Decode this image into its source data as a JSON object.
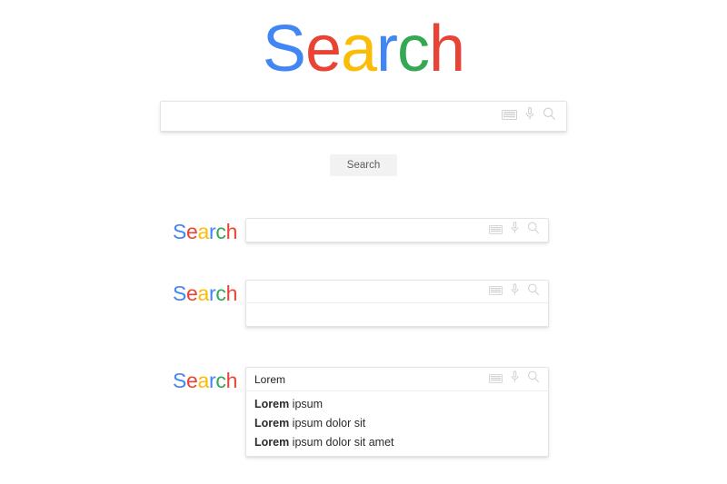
{
  "logo": {
    "letters": [
      {
        "char": "S",
        "color": "#4285F4"
      },
      {
        "char": "e",
        "color": "#EA4335"
      },
      {
        "char": "a",
        "color": "#FBBC05"
      },
      {
        "char": "r",
        "color": "#4285F4"
      },
      {
        "char": "c",
        "color": "#34A853"
      },
      {
        "char": "h",
        "color": "#EA4335"
      }
    ],
    "text": "Search"
  },
  "hero": {
    "input": {
      "value": "",
      "placeholder": ""
    },
    "icons": [
      "keyboard-icon",
      "microphone-icon",
      "magnifier-icon"
    ]
  },
  "button": {
    "label": "Search"
  },
  "row2": {
    "logo": "Search",
    "input": {
      "value": "",
      "placeholder": ""
    }
  },
  "row3": {
    "logo": "Search",
    "input": {
      "value": "",
      "placeholder": ""
    },
    "dropdown_empty": true
  },
  "row4": {
    "logo": "Search",
    "input": {
      "value": "Lorem",
      "placeholder": ""
    },
    "suggestions": [
      {
        "match": "Lorem",
        "rest": " ipsum"
      },
      {
        "match": "Lorem",
        "rest": " ipsum dolor sit"
      },
      {
        "match": "Lorem",
        "rest": " ipsum dolor sit amet"
      }
    ]
  },
  "colors": {
    "blue": "#4285F4",
    "red": "#EA4335",
    "yellow": "#FBBC05",
    "green": "#34A853",
    "icon_gray": "#cfcfcf",
    "button_bg": "#f2f2f2",
    "button_text": "#5b5b5b",
    "border": "#e4e4e4"
  }
}
